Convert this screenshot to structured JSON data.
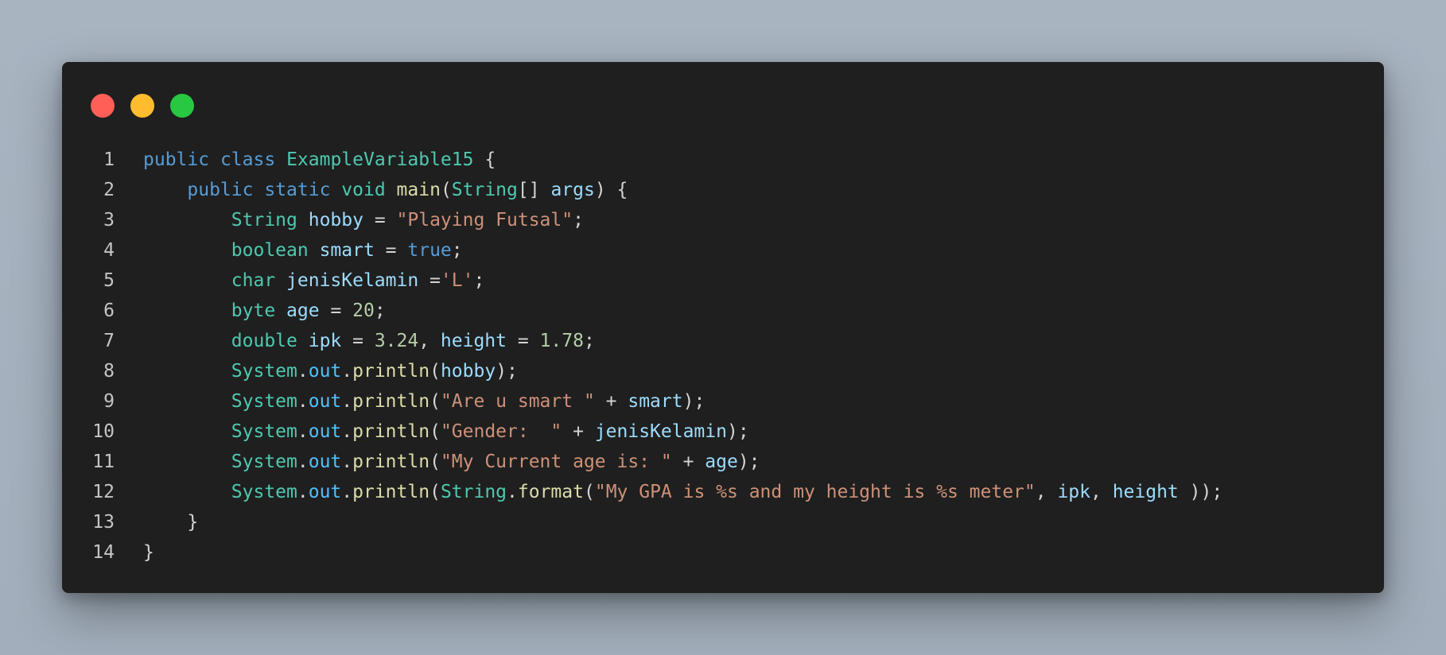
{
  "window": {
    "controls": [
      "close",
      "minimize",
      "maximize"
    ],
    "colors": {
      "close": "#ff5f57",
      "minimize": "#febc2e",
      "maximize": "#28c840",
      "background": "#1f1f1f"
    }
  },
  "code": {
    "lines": [
      {
        "number": "1",
        "tokens": [
          {
            "t": "public",
            "c": "kw"
          },
          {
            "t": " ",
            "c": "pn"
          },
          {
            "t": "class",
            "c": "kw"
          },
          {
            "t": " ",
            "c": "pn"
          },
          {
            "t": "ExampleVariable15",
            "c": "ty"
          },
          {
            "t": " {",
            "c": "pn"
          }
        ]
      },
      {
        "number": "2",
        "tokens": [
          {
            "t": "    ",
            "c": "pn"
          },
          {
            "t": "public",
            "c": "kw"
          },
          {
            "t": " ",
            "c": "pn"
          },
          {
            "t": "static",
            "c": "kw"
          },
          {
            "t": " ",
            "c": "pn"
          },
          {
            "t": "void",
            "c": "ty"
          },
          {
            "t": " ",
            "c": "pn"
          },
          {
            "t": "main",
            "c": "fn"
          },
          {
            "t": "(",
            "c": "pn"
          },
          {
            "t": "String",
            "c": "ty"
          },
          {
            "t": "[] ",
            "c": "pn"
          },
          {
            "t": "args",
            "c": "var"
          },
          {
            "t": ") {",
            "c": "pn"
          }
        ]
      },
      {
        "number": "3",
        "tokens": [
          {
            "t": "        ",
            "c": "pn"
          },
          {
            "t": "String",
            "c": "ty"
          },
          {
            "t": " ",
            "c": "pn"
          },
          {
            "t": "hobby",
            "c": "var"
          },
          {
            "t": " = ",
            "c": "pn"
          },
          {
            "t": "\"Playing Futsal\"",
            "c": "str"
          },
          {
            "t": ";",
            "c": "pn"
          }
        ]
      },
      {
        "number": "4",
        "tokens": [
          {
            "t": "        ",
            "c": "pn"
          },
          {
            "t": "boolean",
            "c": "ty"
          },
          {
            "t": " ",
            "c": "pn"
          },
          {
            "t": "smart",
            "c": "var"
          },
          {
            "t": " = ",
            "c": "pn"
          },
          {
            "t": "true",
            "c": "kw"
          },
          {
            "t": ";",
            "c": "pn"
          }
        ]
      },
      {
        "number": "5",
        "tokens": [
          {
            "t": "        ",
            "c": "pn"
          },
          {
            "t": "char",
            "c": "ty"
          },
          {
            "t": " ",
            "c": "pn"
          },
          {
            "t": "jenisKelamin",
            "c": "var"
          },
          {
            "t": " =",
            "c": "pn"
          },
          {
            "t": "'L'",
            "c": "str"
          },
          {
            "t": ";",
            "c": "pn"
          }
        ]
      },
      {
        "number": "6",
        "tokens": [
          {
            "t": "        ",
            "c": "pn"
          },
          {
            "t": "byte",
            "c": "ty"
          },
          {
            "t": " ",
            "c": "pn"
          },
          {
            "t": "age",
            "c": "var"
          },
          {
            "t": " = ",
            "c": "pn"
          },
          {
            "t": "20",
            "c": "num"
          },
          {
            "t": ";",
            "c": "pn"
          }
        ]
      },
      {
        "number": "7",
        "tokens": [
          {
            "t": "        ",
            "c": "pn"
          },
          {
            "t": "double",
            "c": "ty"
          },
          {
            "t": " ",
            "c": "pn"
          },
          {
            "t": "ipk",
            "c": "var"
          },
          {
            "t": " = ",
            "c": "pn"
          },
          {
            "t": "3.24",
            "c": "num"
          },
          {
            "t": ", ",
            "c": "pn"
          },
          {
            "t": "height",
            "c": "var"
          },
          {
            "t": " = ",
            "c": "pn"
          },
          {
            "t": "1.78",
            "c": "num"
          },
          {
            "t": ";",
            "c": "pn"
          }
        ]
      },
      {
        "number": "8",
        "tokens": [
          {
            "t": "        ",
            "c": "pn"
          },
          {
            "t": "System",
            "c": "ty"
          },
          {
            "t": ".",
            "c": "pn"
          },
          {
            "t": "out",
            "c": "fld"
          },
          {
            "t": ".",
            "c": "pn"
          },
          {
            "t": "println",
            "c": "fn"
          },
          {
            "t": "(",
            "c": "pn"
          },
          {
            "t": "hobby",
            "c": "var"
          },
          {
            "t": ");",
            "c": "pn"
          }
        ]
      },
      {
        "number": "9",
        "tokens": [
          {
            "t": "        ",
            "c": "pn"
          },
          {
            "t": "System",
            "c": "ty"
          },
          {
            "t": ".",
            "c": "pn"
          },
          {
            "t": "out",
            "c": "fld"
          },
          {
            "t": ".",
            "c": "pn"
          },
          {
            "t": "println",
            "c": "fn"
          },
          {
            "t": "(",
            "c": "pn"
          },
          {
            "t": "\"Are u smart \"",
            "c": "str"
          },
          {
            "t": " + ",
            "c": "pn"
          },
          {
            "t": "smart",
            "c": "var"
          },
          {
            "t": ");",
            "c": "pn"
          }
        ]
      },
      {
        "number": "10",
        "tokens": [
          {
            "t": "        ",
            "c": "pn"
          },
          {
            "t": "System",
            "c": "ty"
          },
          {
            "t": ".",
            "c": "pn"
          },
          {
            "t": "out",
            "c": "fld"
          },
          {
            "t": ".",
            "c": "pn"
          },
          {
            "t": "println",
            "c": "fn"
          },
          {
            "t": "(",
            "c": "pn"
          },
          {
            "t": "\"Gender:  \"",
            "c": "str"
          },
          {
            "t": " + ",
            "c": "pn"
          },
          {
            "t": "jenisKelamin",
            "c": "var"
          },
          {
            "t": ");",
            "c": "pn"
          }
        ]
      },
      {
        "number": "11",
        "tokens": [
          {
            "t": "        ",
            "c": "pn"
          },
          {
            "t": "System",
            "c": "ty"
          },
          {
            "t": ".",
            "c": "pn"
          },
          {
            "t": "out",
            "c": "fld"
          },
          {
            "t": ".",
            "c": "pn"
          },
          {
            "t": "println",
            "c": "fn"
          },
          {
            "t": "(",
            "c": "pn"
          },
          {
            "t": "\"My Current age is: \"",
            "c": "str"
          },
          {
            "t": " + ",
            "c": "pn"
          },
          {
            "t": "age",
            "c": "var"
          },
          {
            "t": ");",
            "c": "pn"
          }
        ]
      },
      {
        "number": "12",
        "tokens": [
          {
            "t": "        ",
            "c": "pn"
          },
          {
            "t": "System",
            "c": "ty"
          },
          {
            "t": ".",
            "c": "pn"
          },
          {
            "t": "out",
            "c": "fld"
          },
          {
            "t": ".",
            "c": "pn"
          },
          {
            "t": "println",
            "c": "fn"
          },
          {
            "t": "(",
            "c": "pn"
          },
          {
            "t": "String",
            "c": "ty"
          },
          {
            "t": ".",
            "c": "pn"
          },
          {
            "t": "format",
            "c": "fn"
          },
          {
            "t": "(",
            "c": "pn"
          },
          {
            "t": "\"My GPA is %s and my height is %s meter\"",
            "c": "str"
          },
          {
            "t": ", ",
            "c": "pn"
          },
          {
            "t": "ipk",
            "c": "var"
          },
          {
            "t": ", ",
            "c": "pn"
          },
          {
            "t": "height",
            "c": "var"
          },
          {
            "t": " ));",
            "c": "pn"
          }
        ]
      },
      {
        "number": "13",
        "tokens": [
          {
            "t": "    }",
            "c": "pn"
          }
        ]
      },
      {
        "number": "14",
        "tokens": [
          {
            "t": "}",
            "c": "pn"
          }
        ]
      }
    ]
  }
}
